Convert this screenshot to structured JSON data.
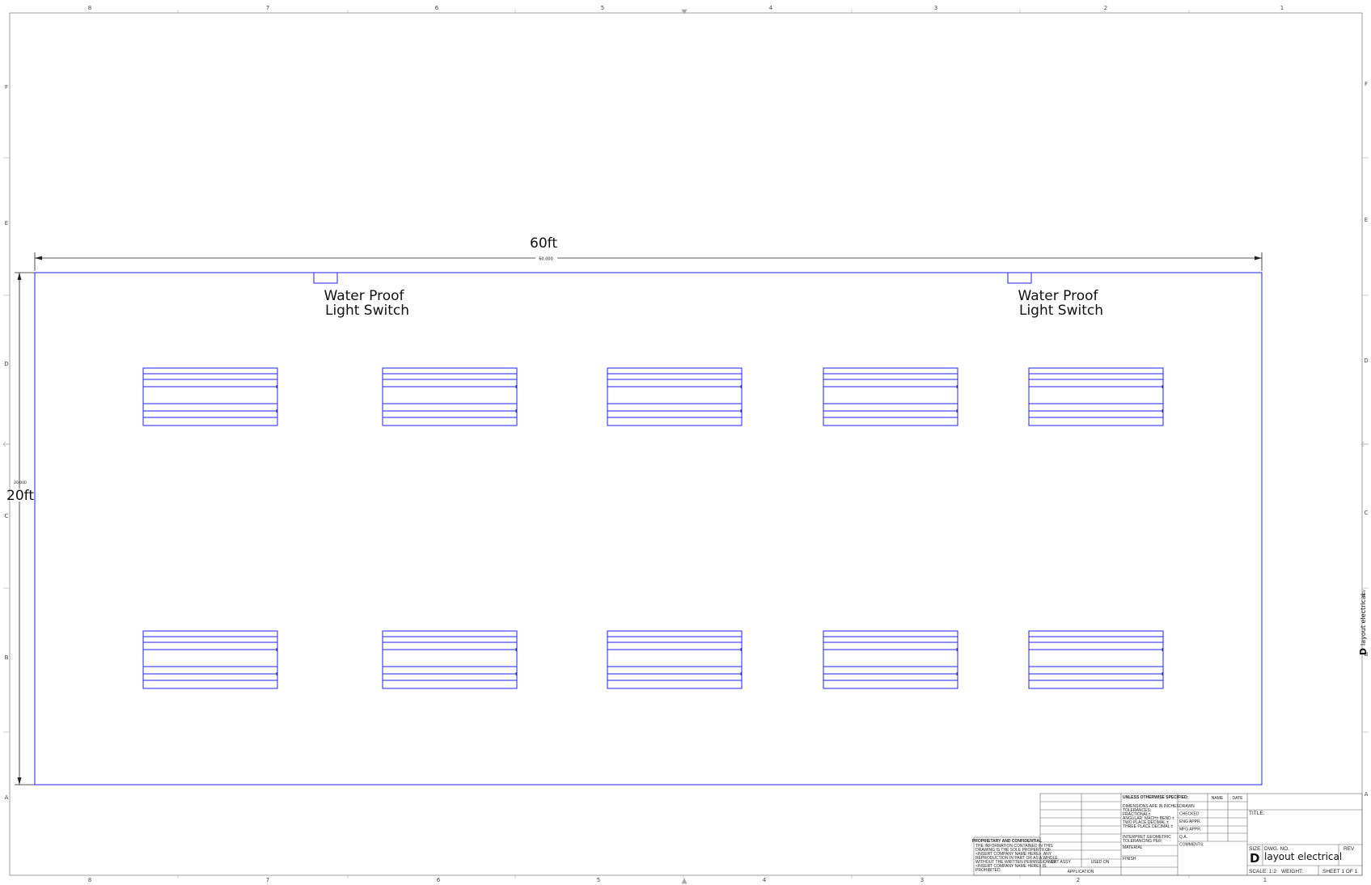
{
  "drawing": {
    "zones_top": [
      "8",
      "7",
      "6",
      "5",
      "4",
      "3",
      "2",
      "1"
    ],
    "zones_bottom": [
      "8",
      "7",
      "6",
      "5",
      "4",
      "3",
      "2",
      "1"
    ],
    "zones_side": [
      "F",
      "E",
      "D",
      "C",
      "B",
      "A"
    ],
    "dim_width_label": "60ft",
    "dim_width_value": "60.000",
    "dim_height_label": "20ft",
    "dim_height_value": "20.000",
    "switch_labels": [
      {
        "line1": "Water Proof",
        "line2": "Light Switch"
      },
      {
        "line1": "Water Proof",
        "line2": "Light Switch"
      }
    ],
    "line_color": "#2222ee",
    "fixture_count_per_row": 5,
    "fixture_rows": 2
  },
  "title_block": {
    "unless": "UNLESS OTHERWISE SPECIFIED:",
    "name": "NAME",
    "date": "DATE",
    "dims": [
      "DIMENSIONS ARE IN INCHES",
      "TOLERANCES:",
      "FRACTIONAL±",
      "ANGULAR: MACH±   BEND ±",
      "TWO PLACE DECIMAL   ±",
      "THREE PLACE DECIMAL  ±"
    ],
    "roles": [
      "DRAWN",
      "CHECKED",
      "ENG APPR.",
      "MFG APPR.",
      "Q.A.",
      "COMMENTS:"
    ],
    "interpret": [
      "INTERPRET GEOMETRIC",
      "TOLERANCING PER:"
    ],
    "material": "MATERIAL",
    "finish": "FINISH",
    "proprietary_title": "PROPRIETARY AND CONFIDENTIAL",
    "proprietary_text": [
      "THE INFORMATION CONTAINED IN THIS",
      "DRAWING IS THE SOLE PROPERTY OF",
      "<INSERT COMPANY NAME HERE>. ANY",
      "REPRODUCTION IN PART OR AS A WHOLE",
      "WITHOUT THE WRITTEN PERMISSION OF",
      "<INSERT COMPANY NAME HERE> IS",
      "PROHIBITED."
    ],
    "next_assy": "NEXT ASSY",
    "used_on": "USED ON",
    "application": "APPLICATION",
    "title_label": "TITLE:",
    "size_label": "SIZE",
    "size": "D",
    "dwg_no_label": "DWG.  NO.",
    "dwg_no": "layout electrical",
    "rev": "REV",
    "scale": "SCALE: 1:2",
    "weight": "WEIGHT:",
    "sheet": "SHEET 1 OF 1",
    "side_ref_size": "D",
    "side_ref_name": "layout electrical",
    "side_ref_rev": "REV"
  }
}
